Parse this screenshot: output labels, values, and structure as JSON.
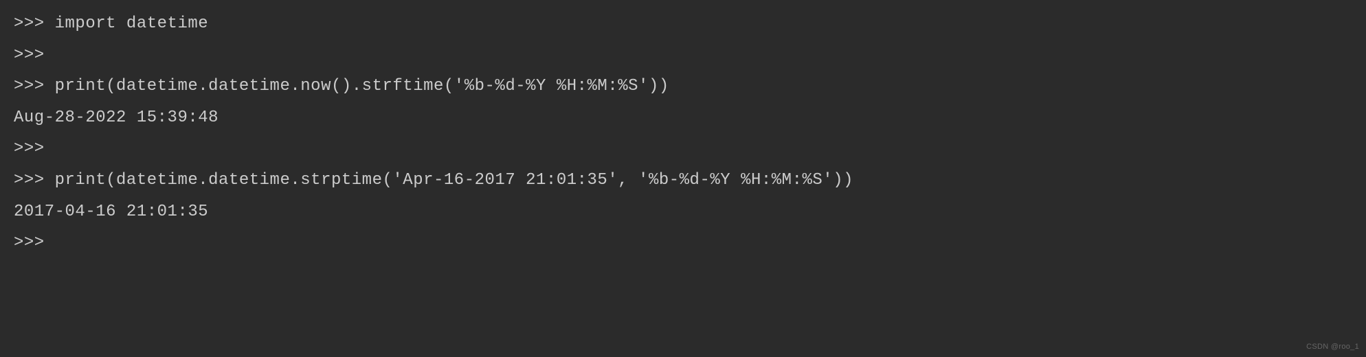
{
  "terminal": {
    "lines": [
      ">>> import datetime",
      ">>> ",
      ">>> print(datetime.datetime.now().strftime('%b-%d-%Y %H:%M:%S'))",
      "Aug-28-2022 15:39:48",
      ">>> ",
      ">>> print(datetime.datetime.strptime('Apr-16-2017 21:01:35', '%b-%d-%Y %H:%M:%S'))",
      "2017-04-16 21:01:35",
      ">>> "
    ]
  },
  "watermark": "CSDN @roo_1"
}
